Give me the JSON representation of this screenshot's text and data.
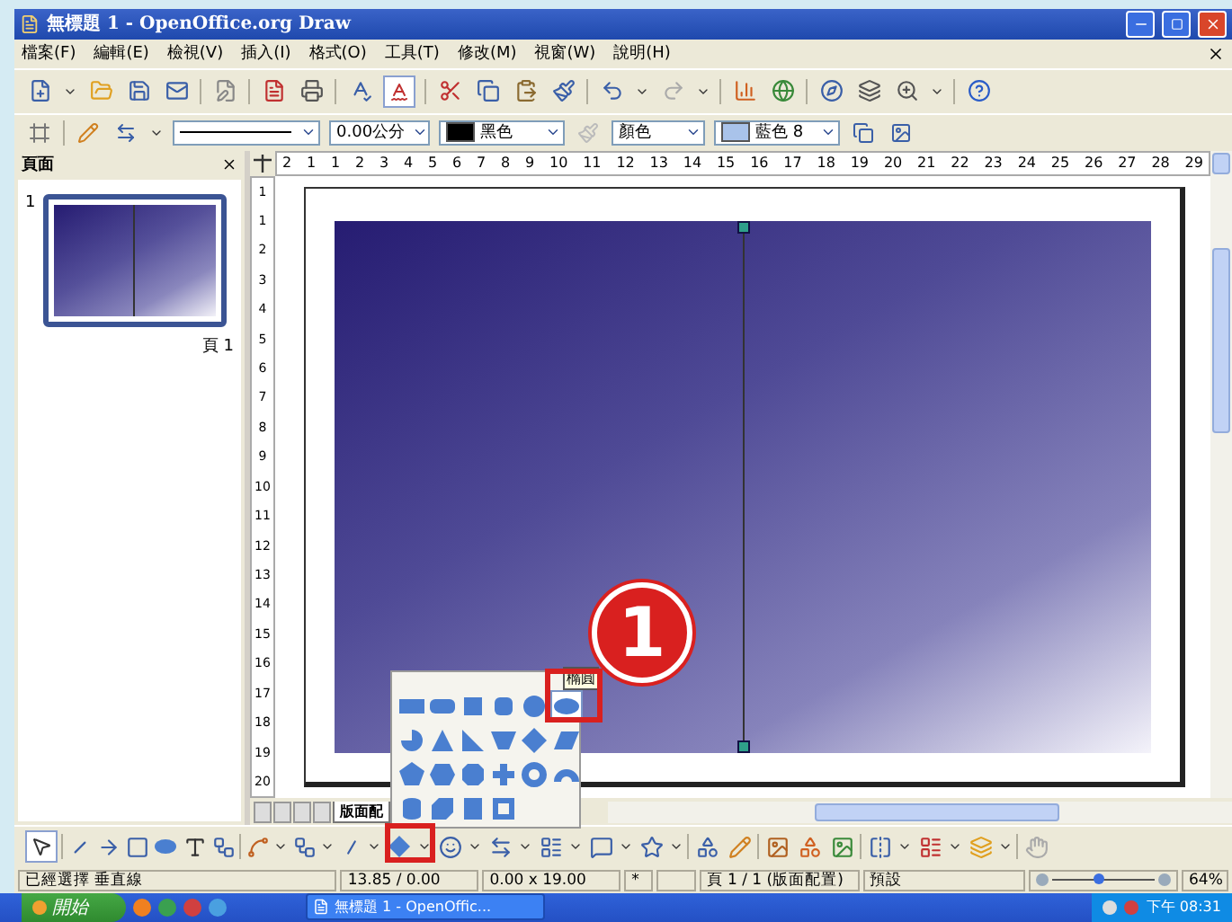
{
  "window": {
    "title": "無標題 1 - OpenOffice.org Draw"
  },
  "menu": [
    "檔案(F)",
    "編輯(E)",
    "檢視(V)",
    "插入(I)",
    "格式(O)",
    "工具(T)",
    "修改(M)",
    "視窗(W)",
    "說明(H)"
  ],
  "line_toolbar": {
    "line_width": "0.00公分",
    "line_color": "黑色",
    "area_style": "顏色",
    "area_color": "藍色 8"
  },
  "pages_panel": {
    "title": "頁面",
    "pages": [
      {
        "number": "1",
        "label": "頁 1",
        "selected": true
      }
    ]
  },
  "rulers": {
    "horizontal": [
      "2",
      "1",
      "1",
      "2",
      "3",
      "4",
      "5",
      "6",
      "7",
      "8",
      "9",
      "10",
      "11",
      "12",
      "13",
      "14",
      "15",
      "16",
      "17",
      "18",
      "19",
      "20",
      "21",
      "22",
      "23",
      "24",
      "25",
      "26",
      "27",
      "28",
      "29"
    ],
    "vertical": [
      "1",
      "1",
      "2",
      "3",
      "4",
      "5",
      "6",
      "7",
      "8",
      "9",
      "10",
      "11",
      "12",
      "13",
      "14",
      "15",
      "16",
      "17",
      "18",
      "19",
      "20"
    ]
  },
  "sheet_tab": "版面配",
  "shape_popup": {
    "tooltip": "橢圓",
    "shapes": [
      {
        "kind": "rect",
        "highlighted": false
      },
      {
        "kind": "rounded-rect",
        "highlighted": false
      },
      {
        "kind": "square",
        "highlighted": false
      },
      {
        "kind": "rounded-square",
        "highlighted": false
      },
      {
        "kind": "circle",
        "highlighted": false
      },
      {
        "kind": "ellipse",
        "highlighted": true
      },
      {
        "kind": "pie",
        "highlighted": false
      },
      {
        "kind": "triangle",
        "highlighted": false
      },
      {
        "kind": "right-triangle",
        "highlighted": false
      },
      {
        "kind": "trapezoid",
        "highlighted": false
      },
      {
        "kind": "diamond",
        "highlighted": false
      },
      {
        "kind": "parallelogram",
        "highlighted": false
      },
      {
        "kind": "pentagon",
        "highlighted": false
      },
      {
        "kind": "hexagon",
        "highlighted": false
      },
      {
        "kind": "octagon",
        "highlighted": false
      },
      {
        "kind": "cross",
        "highlighted": false
      },
      {
        "kind": "ring",
        "highlighted": false
      },
      {
        "kind": "arc",
        "highlighted": false
      },
      {
        "kind": "cylinder",
        "highlighted": false
      },
      {
        "kind": "cube",
        "highlighted": false
      },
      {
        "kind": "folded",
        "highlighted": false
      },
      {
        "kind": "frame",
        "highlighted": false
      }
    ]
  },
  "callout": "1",
  "status_bar": {
    "selection": "已經選擇 垂直線",
    "position": "13.85 / 0.00",
    "size": "0.00 x 19.00",
    "modified": "*",
    "page": "頁 1 / 1 (版面配置)",
    "layout": "預設",
    "zoom_slider": {
      "level": 0.45
    },
    "zoom": "64%"
  },
  "taskbar": {
    "start": "開始",
    "task": "無標題 1 - OpenOffic...",
    "clock": "下午 08:31"
  }
}
